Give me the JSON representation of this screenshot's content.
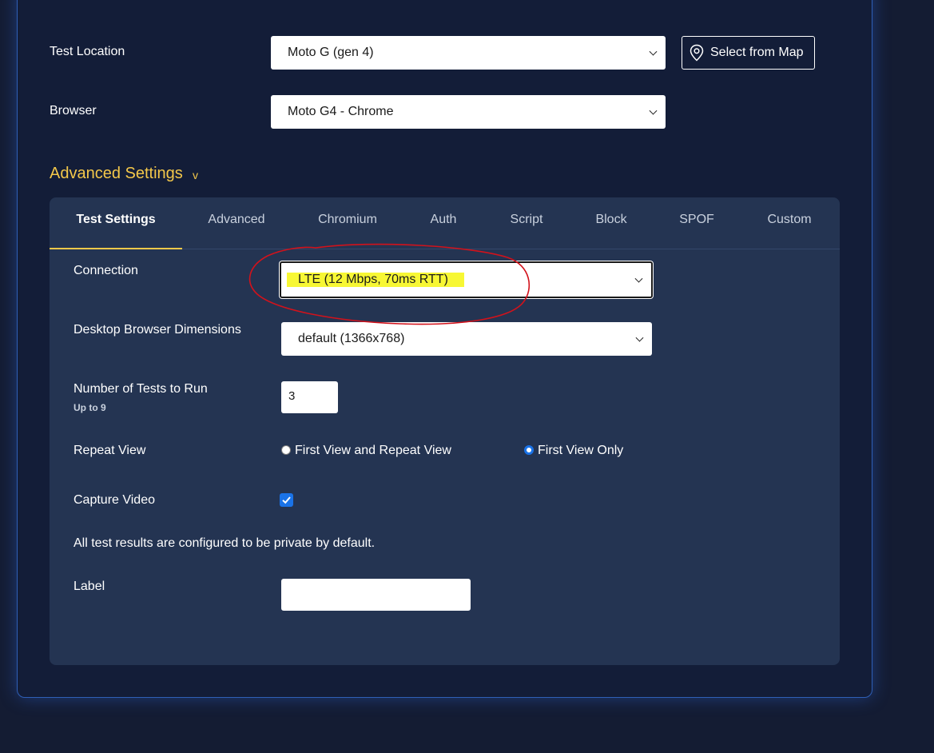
{
  "test_location": {
    "label": "Test Location",
    "selected": "Moto G (gen 4)",
    "map_button": "Select from Map"
  },
  "browser": {
    "label": "Browser",
    "selected": "Moto G4 - Chrome"
  },
  "advanced": {
    "title": "Advanced Settings",
    "toggle_glyph": "v",
    "tabs": [
      "Test Settings",
      "Advanced",
      "Chromium",
      "Auth",
      "Script",
      "Block",
      "SPOF",
      "Custom"
    ],
    "active_tab": "Test Settings"
  },
  "settings": {
    "connection": {
      "label": "Connection",
      "selected": "LTE (12 Mbps, 70ms RTT)"
    },
    "dimensions": {
      "label": "Desktop Browser Dimensions",
      "selected": "default (1366x768)"
    },
    "num_tests": {
      "label": "Number of Tests to Run",
      "hint": "Up to 9",
      "value": "3"
    },
    "repeat_view": {
      "label": "Repeat View",
      "options": [
        "First View and Repeat View",
        "First View Only"
      ],
      "selected_index": 1
    },
    "capture_video": {
      "label": "Capture Video",
      "checked": true
    },
    "privacy_note": "All test results are configured to be private by default.",
    "label_field": {
      "label": "Label",
      "value": ""
    }
  },
  "colors": {
    "page_bg": "#141c33",
    "card_bg": "#131d38",
    "panel_bg": "#243452",
    "accent_gold": "#f4c84a",
    "checkbox_blue": "#1a73e8",
    "highlight_yellow": "#f7f734",
    "annotation_red": "#d2121b"
  }
}
